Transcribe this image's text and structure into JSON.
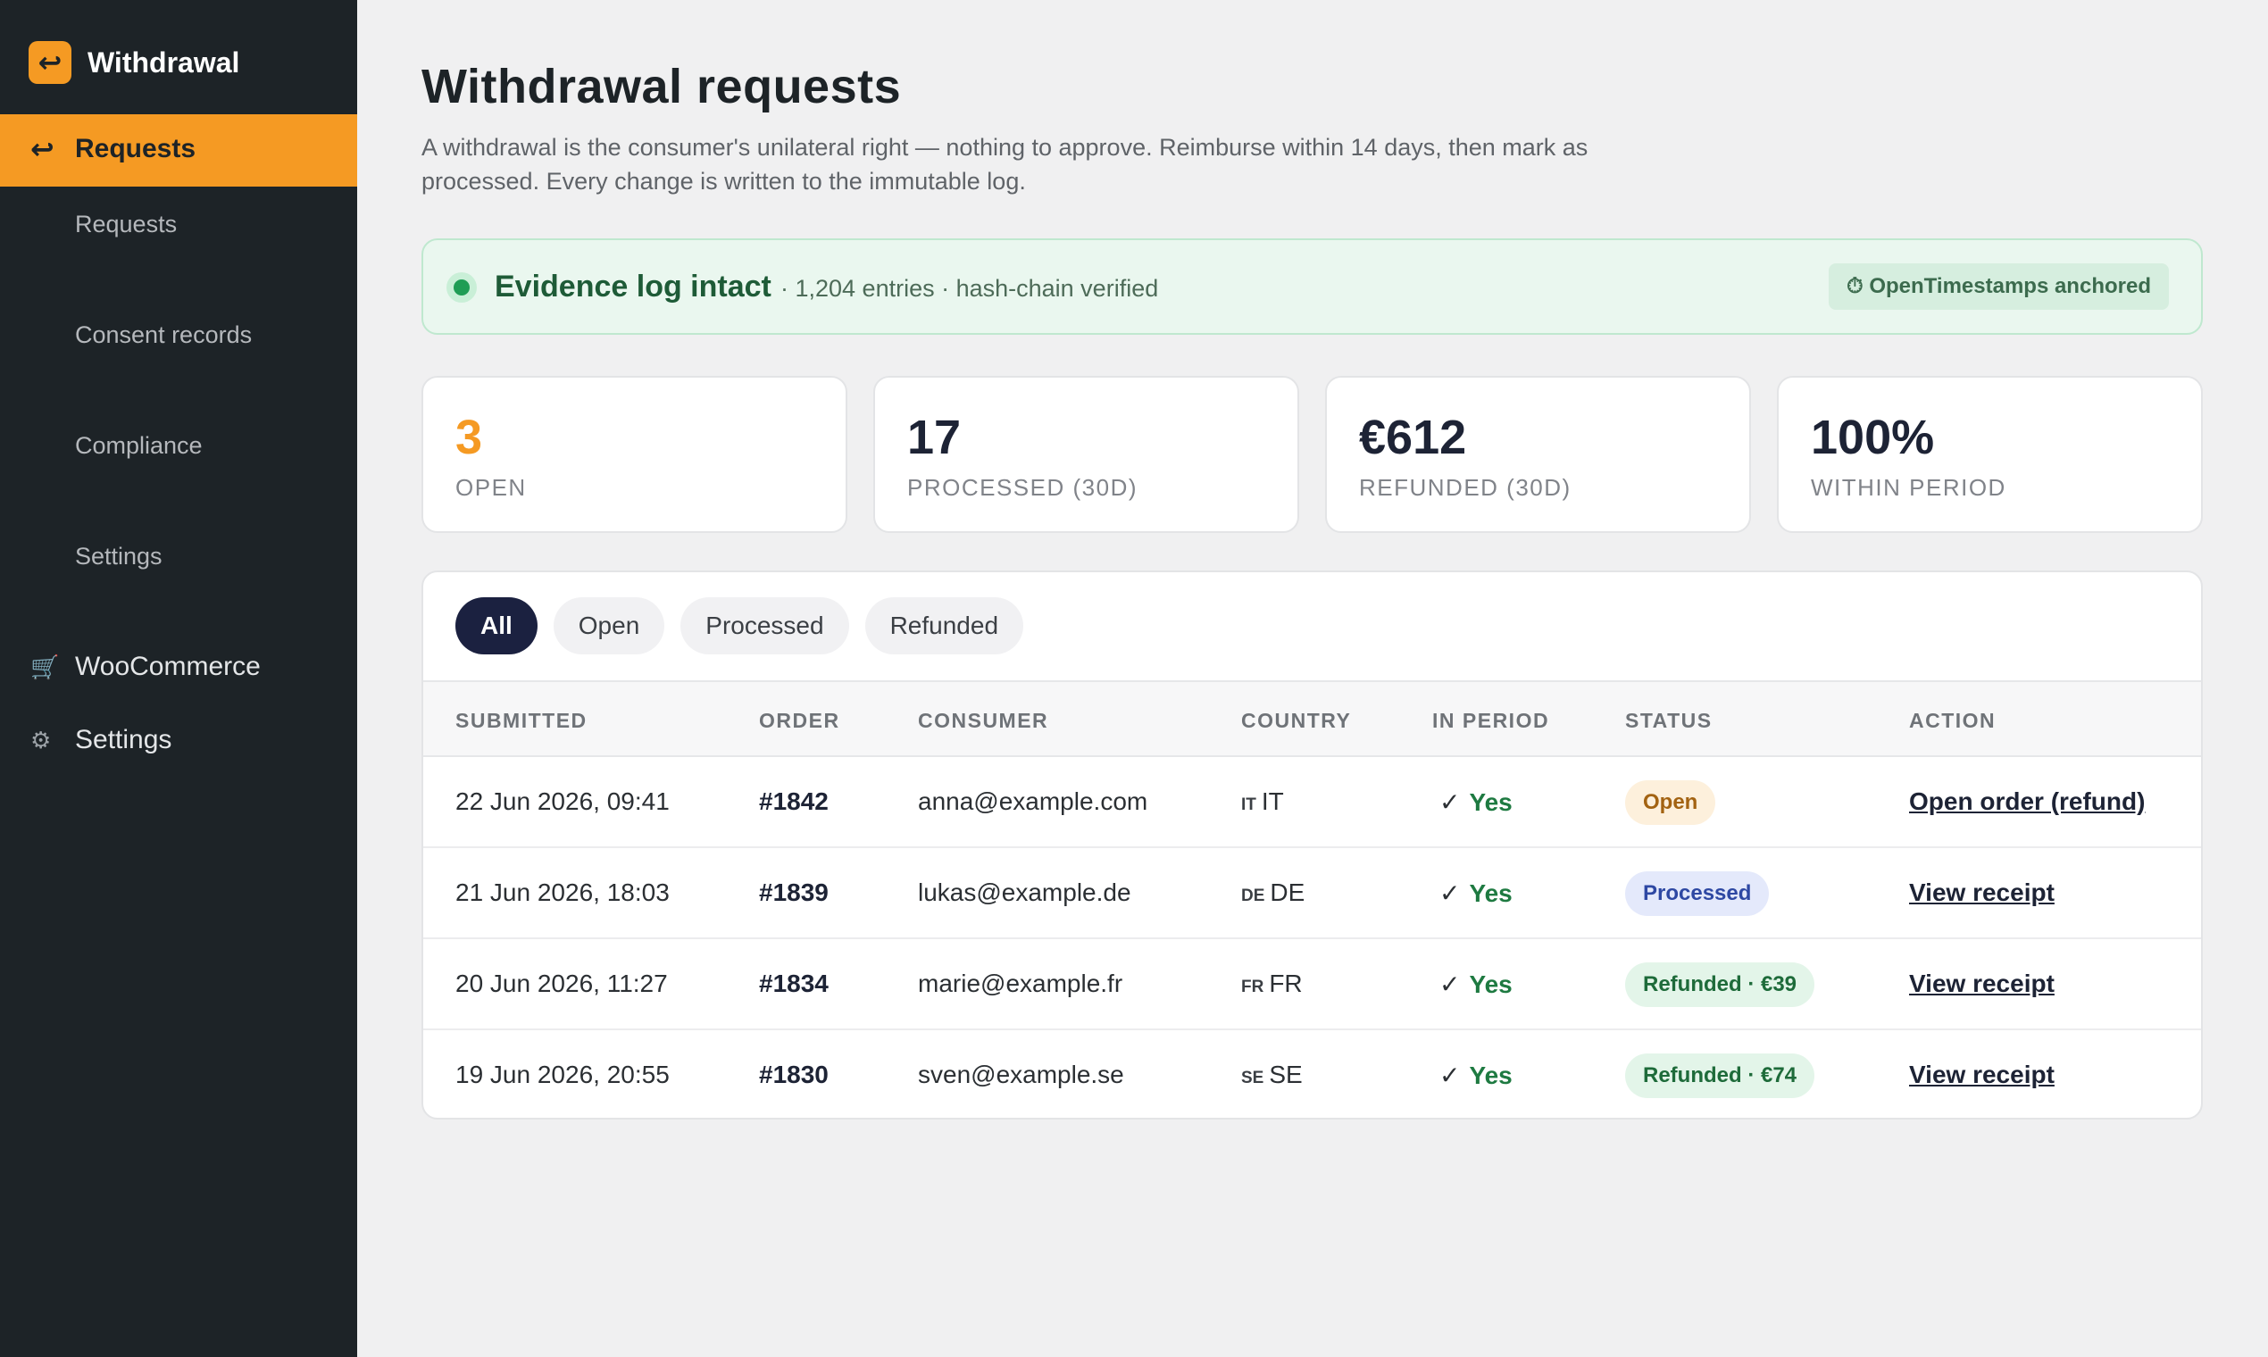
{
  "app": {
    "name": "Withdrawal",
    "logo_glyph": "↩"
  },
  "sidebar": {
    "active": {
      "label": "Requests",
      "icon": "return-arrow-icon",
      "glyph": "↩"
    },
    "submenu": [
      {
        "label": "Requests"
      },
      {
        "label": "Consent records"
      },
      {
        "label": "Compliance"
      },
      {
        "label": "Settings"
      }
    ],
    "items": [
      {
        "label": "WooCommerce",
        "icon": "cart-icon",
        "glyph": "🛒"
      },
      {
        "label": "Settings",
        "icon": "gear-icon",
        "glyph": "⚙"
      }
    ]
  },
  "header": {
    "title": "Withdrawal requests",
    "description": "A withdrawal is the consumer's unilateral right — nothing to approve. Reimburse within 14 days, then mark as processed. Every change is written to the immutable log."
  },
  "evidence": {
    "title": "Evidence log intact",
    "meta": "· 1,204 entries · hash-chain verified",
    "badge": "⏱ OpenTimestamps anchored",
    "status_color": "#1f9d55"
  },
  "stats": [
    {
      "value": "3",
      "label": "OPEN",
      "accent": true
    },
    {
      "value": "17",
      "label": "PROCESSED (30D)",
      "accent": false
    },
    {
      "value": "€612",
      "label": "REFUNDED (30D)",
      "accent": false
    },
    {
      "value": "100%",
      "label": "WITHIN PERIOD",
      "accent": false
    }
  ],
  "filters": [
    {
      "label": "All",
      "active": true
    },
    {
      "label": "Open",
      "active": false
    },
    {
      "label": "Processed",
      "active": false
    },
    {
      "label": "Refunded",
      "active": false
    }
  ],
  "table": {
    "columns": [
      "SUBMITTED",
      "ORDER",
      "CONSUMER",
      "COUNTRY",
      "IN PERIOD",
      "STATUS",
      "ACTION"
    ],
    "rows": [
      {
        "submitted": "22 Jun 2026, 09:41",
        "order": "#1842",
        "consumer": "anna@example.com",
        "flag": "IT",
        "country": "IT",
        "check": "✓",
        "in_period": "Yes",
        "status": "Open",
        "status_type": "open",
        "action": "Open order (refund)"
      },
      {
        "submitted": "21 Jun 2026, 18:03",
        "order": "#1839",
        "consumer": "lukas@example.de",
        "flag": "DE",
        "country": "DE",
        "check": "✓",
        "in_period": "Yes",
        "status": "Processed",
        "status_type": "processed",
        "action": "View receipt"
      },
      {
        "submitted": "20 Jun 2026, 11:27",
        "order": "#1834",
        "consumer": "marie@example.fr",
        "flag": "FR",
        "country": "FR",
        "check": "✓",
        "in_period": "Yes",
        "status": "Refunded · €39",
        "status_type": "refunded",
        "action": "View receipt"
      },
      {
        "submitted": "19 Jun 2026, 20:55",
        "order": "#1830",
        "consumer": "sven@example.se",
        "flag": "SE",
        "country": "SE",
        "check": "✓",
        "in_period": "Yes",
        "status": "Refunded · €74",
        "status_type": "refunded",
        "action": "View receipt"
      }
    ]
  },
  "colors": {
    "accent": "#f59a23",
    "sidebar_bg": "#1d2327",
    "filter_active": "#1b2140"
  }
}
